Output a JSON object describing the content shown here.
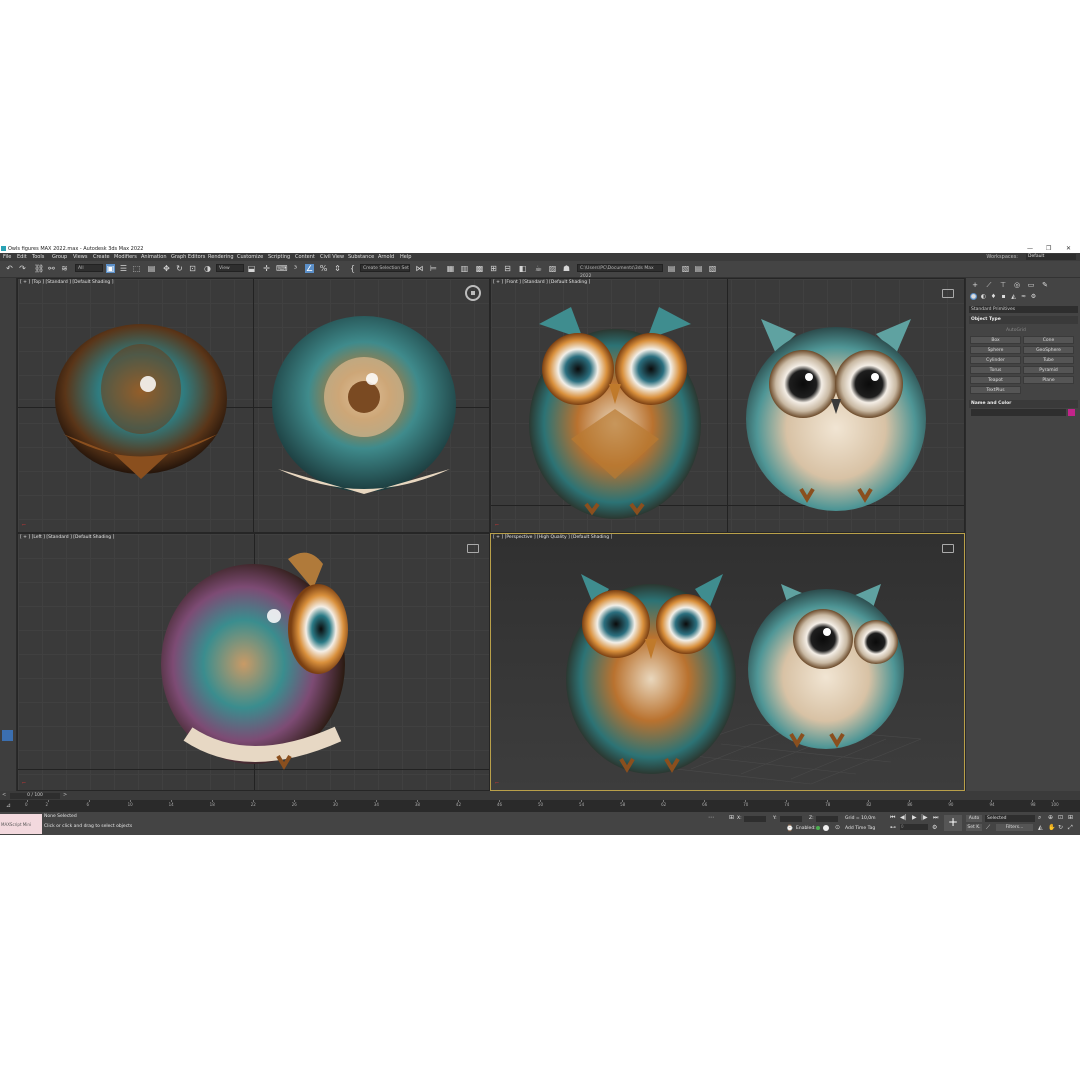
{
  "window": {
    "title": "Owls figures MAX 2022.max - Autodesk 3ds Max 2022",
    "minimize_icon": "—",
    "maximize_icon": "❐",
    "close_icon": "✕"
  },
  "menu": {
    "items": [
      "File",
      "Edit",
      "Tools",
      "Group",
      "Views",
      "Create",
      "Modifiers",
      "Animation",
      "Graph Editors",
      "Rendering",
      "Customize",
      "Scripting",
      "Content",
      "Civil View",
      "Substance",
      "Arnold",
      "Help"
    ],
    "workspaces_label": "Workspaces:",
    "workspace_value": "Default"
  },
  "toolbar": {
    "selection_filter": "All",
    "view_dropdown": "View",
    "named_selection": "Create Selection Set",
    "project_path": "C:\\Users\\PC\\Documents\\3ds Max 2022"
  },
  "viewports": {
    "top": "[ + ] [Top ] [Standard ] [Default Shading ]",
    "front": "[ + ] [Front ] [Standard ] [Default Shading ]",
    "left": "[ + ] [Left ] [Standard ] [Default Shading ]",
    "perspective": "[ + ] [Perspective ] [High Quality ] [Default Shading ]"
  },
  "command_panel": {
    "category": "Standard Primitives",
    "object_type_title": "Object Type",
    "autogrid": "AutoGrid",
    "primitives": [
      "Box",
      "Cone",
      "Sphere",
      "GeoSphere",
      "Cylinder",
      "Tube",
      "Torus",
      "Pyramid",
      "Teapot",
      "Plane",
      "TextPlus"
    ],
    "name_color_title": "Name and Color",
    "object_color": "#c2248a"
  },
  "timeline": {
    "frame_counter": "0 / 100",
    "ticks": [
      "0",
      "2",
      "6",
      "10",
      "14",
      "18",
      "22",
      "26",
      "30",
      "34",
      "38",
      "42",
      "46",
      "50",
      "54",
      "58",
      "62",
      "66",
      "70",
      "74",
      "78",
      "82",
      "86",
      "90",
      "94",
      "98",
      "100"
    ]
  },
  "status": {
    "maxscript": "MAXScript Mini",
    "selection": "None Selected",
    "prompt": "Click or click and drag to select objects",
    "x_label": "X:",
    "y_label": "Y:",
    "z_label": "Z:",
    "grid": "Grid = 10,0m",
    "enabled": "Enabled:",
    "add_time_tag": "Add Time Tag",
    "auto": "Auto",
    "selected": "Selected",
    "set_key": "Set K.",
    "filters": "Filters...",
    "frame_field": "0"
  }
}
